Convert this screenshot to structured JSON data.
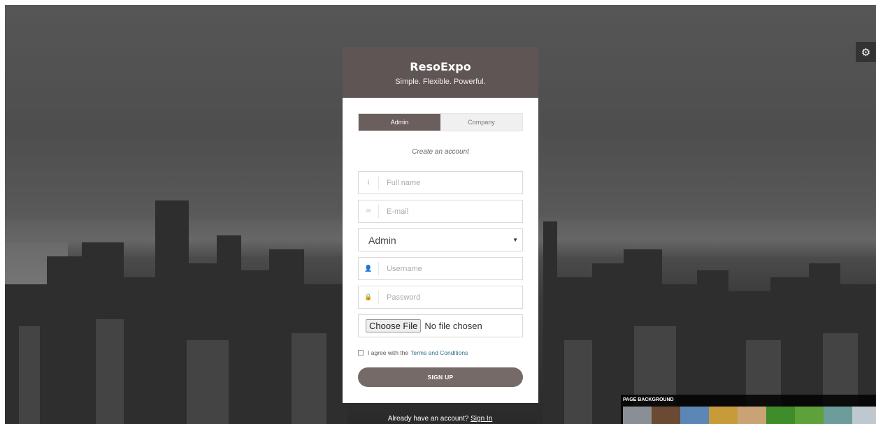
{
  "brand": {
    "title": "ResoExpo",
    "tagline": "Simple. Flexible. Powerful."
  },
  "tabs": [
    {
      "label": "Admin",
      "active": true
    },
    {
      "label": "Company",
      "active": false
    }
  ],
  "form": {
    "heading": "Create an account",
    "full_name": {
      "placeholder": "Full name",
      "icon": "info-icon"
    },
    "email": {
      "placeholder": "E-mail",
      "icon": "envelope-icon"
    },
    "role": {
      "selected": "Admin"
    },
    "username": {
      "placeholder": "Username",
      "icon": "user-icon"
    },
    "password": {
      "placeholder": "Password",
      "icon": "lock-icon"
    },
    "file": {
      "button_label": "Choose File",
      "status": "No file chosen"
    },
    "agree_text": "I agree with the",
    "terms_link": "Terms and Conditions",
    "submit_label": "SIGN UP"
  },
  "footer": {
    "prompt": "Already have an account?",
    "signin_link": "Sign In"
  },
  "background_picker": {
    "label": "PAGE BACKGROUND",
    "thumbnails": [
      {
        "name": "city-aerial",
        "color": "#8a8f95"
      },
      {
        "name": "market",
        "color": "#6a4a32"
      },
      {
        "name": "mountains",
        "color": "#5b86b5"
      },
      {
        "name": "wheat",
        "color": "#c79a3a"
      },
      {
        "name": "feather",
        "color": "#c9a276"
      },
      {
        "name": "grass",
        "color": "#3f8c2a"
      },
      {
        "name": "field",
        "color": "#5ea03a"
      },
      {
        "name": "tree",
        "color": "#6d9c9a"
      },
      {
        "name": "more",
        "color": "#bfc7cf"
      }
    ]
  },
  "colors": {
    "header_bg": "#5f5555",
    "active_tab": "#6b5f5e",
    "button": "#766a69",
    "link": "#2e6f8c"
  }
}
